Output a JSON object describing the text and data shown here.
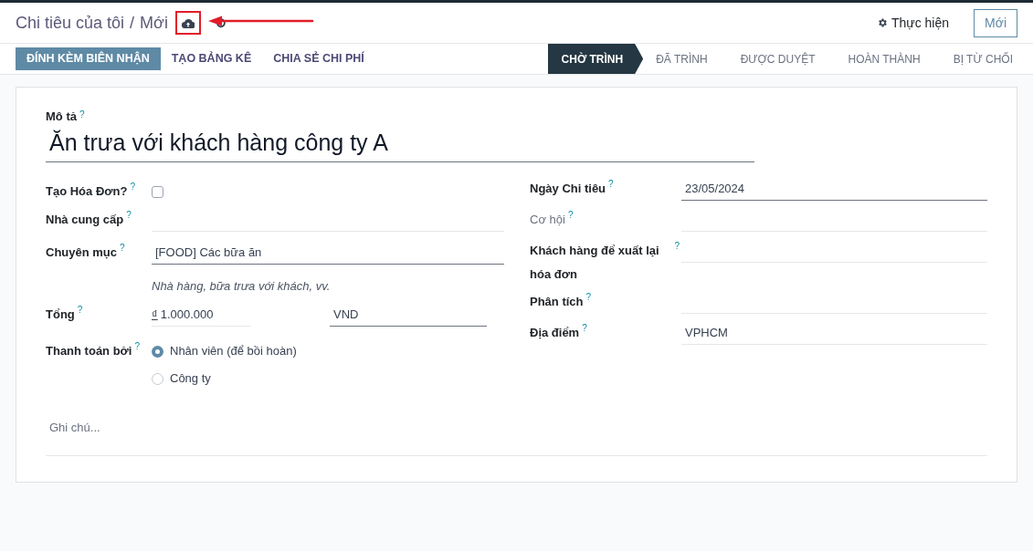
{
  "breadcrumb": {
    "parent": "Chi tiêu của tôi",
    "separator": "/",
    "current": "Mới"
  },
  "actions": {
    "gear_label": "Thực hiện",
    "new_button": "Mới"
  },
  "buttons": [
    {
      "label": "ĐÍNH KÈM BIÊN NHẬN",
      "primary": true
    },
    {
      "label": "TẠO BẢNG KÊ",
      "primary": false
    },
    {
      "label": "CHIA SẺ CHI PHÍ",
      "primary": false
    }
  ],
  "status_stages": [
    {
      "label": "CHỜ TRÌNH",
      "selected": true
    },
    {
      "label": "ĐÃ TRÌNH",
      "selected": false
    },
    {
      "label": "ĐƯỢC DUYỆT",
      "selected": false
    },
    {
      "label": "HOÀN THÀNH",
      "selected": false
    },
    {
      "label": "BỊ TỪ CHỐI",
      "selected": false
    }
  ],
  "description": {
    "label": "Mô tả",
    "help": "?",
    "value": "Ăn trưa với khách hàng công ty A"
  },
  "left_fields": [
    {
      "kind": "checkbox",
      "label": "Tạo Hóa Đơn?",
      "help": "?",
      "checked": false
    },
    {
      "kind": "text",
      "label": "Nhà cung cấp",
      "help": "?",
      "required": false
    },
    {
      "kind": "text",
      "label": "Chuyên mục",
      "help": "?",
      "value": "[FOOD] Các bữa ăn",
      "required": true,
      "note": "Nhà hàng, bữa trưa với khách, vv."
    },
    {
      "kind": "amount",
      "label": "Tổng",
      "help": "?",
      "symbol": "₫",
      "value": "1.000.000",
      "currency": "VND"
    },
    {
      "kind": "radio",
      "label": "Thanh toán bởi",
      "help": "?",
      "options": [
        {
          "label": "Nhân viên (để bồi hoàn)",
          "selected": true
        },
        {
          "label": "Công ty",
          "selected": false
        }
      ]
    }
  ],
  "right_fields": [
    {
      "kind": "text",
      "label": "Ngày Chi tiêu",
      "help": "?",
      "value": "23/05/2024",
      "required": true,
      "disabled": false
    },
    {
      "kind": "text",
      "label": "Cơ hội",
      "help": "?",
      "required": false,
      "disabled": true
    },
    {
      "kind": "text",
      "label": "Khách hàng để xuất lại hóa đơn",
      "help": "?",
      "required": false,
      "disabled": false
    },
    {
      "kind": "text",
      "label": "Phân tích",
      "help": "?",
      "required": false,
      "disabled": false
    },
    {
      "kind": "text",
      "label": "Địa điểm",
      "help": "?",
      "value": "VPHCM",
      "required": false,
      "disabled": false
    }
  ],
  "notes": {
    "placeholder": "Ghi chú..."
  }
}
